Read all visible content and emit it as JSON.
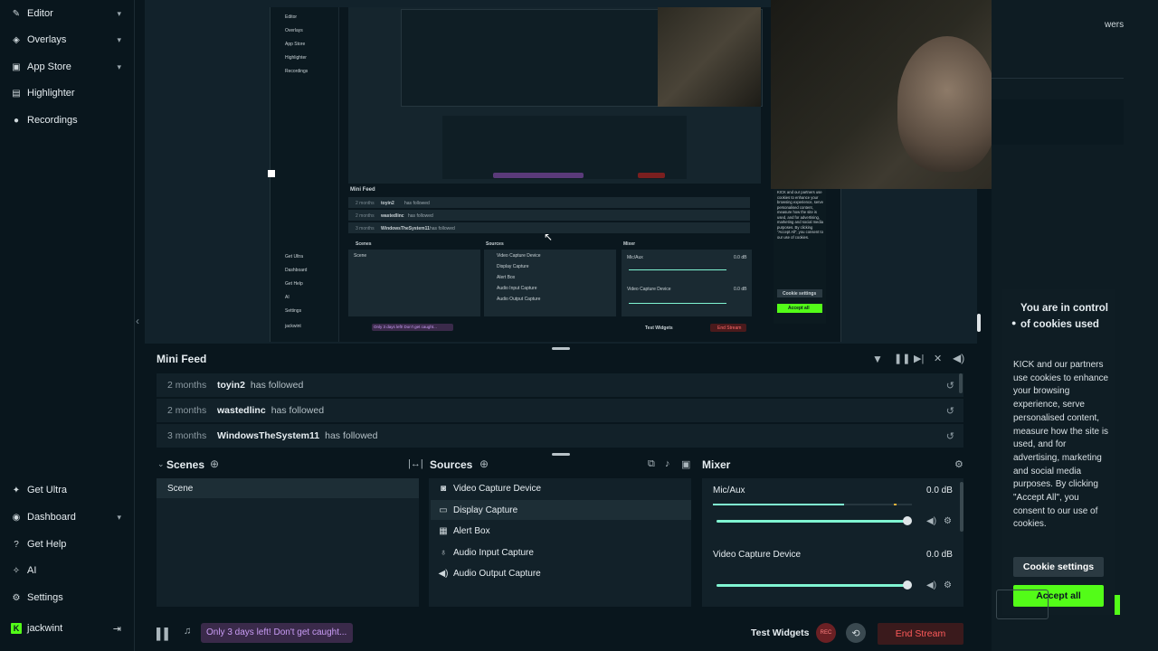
{
  "sidebar": {
    "items": [
      {
        "label": "Editor",
        "icon": "brush-icon"
      },
      {
        "label": "Overlays",
        "icon": "overlay-icon"
      },
      {
        "label": "App Store",
        "icon": "store-icon"
      },
      {
        "label": "Highlighter",
        "icon": "highlighter-icon"
      },
      {
        "label": "Recordings",
        "icon": "record-icon"
      }
    ],
    "bottom_items": [
      {
        "label": "Get Ultra",
        "icon": "ultra-icon"
      },
      {
        "label": "Dashboard",
        "icon": "dashboard-icon"
      },
      {
        "label": "Get Help",
        "icon": "help-icon"
      },
      {
        "label": "AI",
        "icon": "ai-sparkle-icon"
      },
      {
        "label": "Settings",
        "icon": "gear-icon"
      }
    ],
    "user": {
      "name": "jackwint",
      "logo": "K"
    }
  },
  "top_right_fragment": "wers",
  "mini_feed": {
    "title": "Mini Feed",
    "rows": [
      {
        "time": "2 months",
        "user": "toyin2",
        "event": "has followed"
      },
      {
        "time": "2 months",
        "user": "wastedlinc",
        "event": "has followed"
      },
      {
        "time": "3 months",
        "user": "WindowsTheSystem11",
        "event": "has followed"
      }
    ]
  },
  "scenes": {
    "title": "Scenes",
    "items": [
      "Scene"
    ]
  },
  "sources": {
    "title": "Sources",
    "items": [
      {
        "label": "Video Capture Device",
        "icon": "webcam-icon"
      },
      {
        "label": "Display Capture",
        "icon": "monitor-icon"
      },
      {
        "label": "Alert Box",
        "icon": "alert-box-icon"
      },
      {
        "label": "Audio Input Capture",
        "icon": "microphone-icon"
      },
      {
        "label": "Audio Output Capture",
        "icon": "speaker-icon"
      }
    ]
  },
  "mixer": {
    "title": "Mixer",
    "channels": [
      {
        "name": "Mic/Aux",
        "level": "0.0 dB",
        "volume": 1.0
      },
      {
        "name": "Video Capture Device",
        "level": "0.0 dB",
        "volume": 1.0
      }
    ]
  },
  "footer": {
    "promo": "Only 3 days left! Don't get caught...",
    "test_widgets": "Test Widgets",
    "rec_label": "REC",
    "end_stream": "End Stream"
  },
  "cookie": {
    "title": "You are in control of cookies used",
    "body": "KICK and our partners use cookies to enhance your browsing experience, serve personalised content, measure how the site is used, and for advertising, marketing and social media purposes. By clicking \"Accept All\", you consent to our use of cookies.",
    "settings_button": "Cookie settings",
    "accept_button": "Accept all"
  },
  "nested_preview": {
    "nav": [
      "Editor",
      "Overlays",
      "App Store",
      "Highlighter",
      "Recordings"
    ],
    "bottom": [
      "Get Ultra",
      "Dashboard",
      "Get Help",
      "AI",
      "Settings",
      "jackwint"
    ],
    "mini_feed_title": "Mini Feed",
    "feed": [
      {
        "time": "2 months",
        "user": "toyin2",
        "event": "has followed"
      },
      {
        "time": "2 months",
        "user": "wastedlinc",
        "event": "has followed"
      },
      {
        "time": "3 months",
        "user": "WindowsTheSystem11",
        "event": "has followed"
      }
    ],
    "scenes": "Scenes",
    "scene_item": "Scene",
    "sources": "Sources",
    "source_items": [
      "Video Capture Device",
      "Display Capture",
      "Alert Box",
      "Audio Input Capture",
      "Audio Output Capture"
    ],
    "mixer": "Mixer",
    "mic": "Mic/Aux",
    "vcd": "Video Capture Device",
    "db": "0.0 dB",
    "promo": "Only 3 days left! Don't get caught...",
    "test_widgets": "Test Widgets",
    "end_stream": "End Stream",
    "cookie_text": "KICK and our partners use cookies to enhance your browsing experience, serve personalised content, measure how the site is used, and for advertising, marketing and social media purposes. By clicking \"Accept All\", you consent to our use of cookies.",
    "cookie_settings": "Cookie settings",
    "accept_all": "Accept all"
  },
  "colors": {
    "accent": "#80f5d2",
    "kick_green": "#53fc18",
    "end_stream": "#d92b2b",
    "promo_bg": "#3a2a4a",
    "promo_text": "#c99cf5"
  }
}
